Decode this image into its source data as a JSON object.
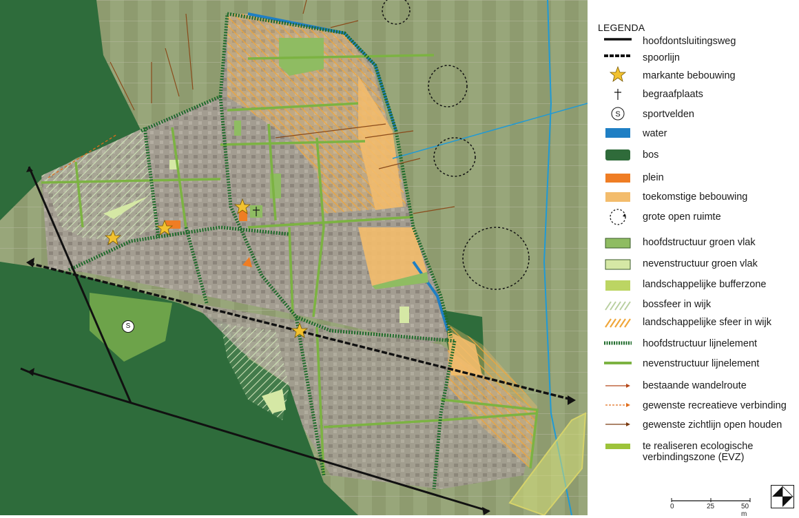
{
  "legend": {
    "title": "LEGENDA",
    "items": [
      {
        "symbol": "thick-black-line",
        "label": "hoofdontsluitingsweg"
      },
      {
        "symbol": "dashed-black-line",
        "label": "spoorlijn"
      },
      {
        "symbol": "star-icon",
        "label": "markante bebouwing"
      },
      {
        "symbol": "cross-icon",
        "label": "begraafplaats"
      },
      {
        "symbol": "sport-circle-icon",
        "label": "sportvelden",
        "glyph": "S"
      },
      {
        "symbol": "blue-swatch",
        "label": "water",
        "color": "#1f7fc4"
      },
      {
        "symbol": "dark-green-swatch",
        "label": "bos",
        "color": "#2f6b3a"
      },
      {
        "symbol": "orange-swatch",
        "label": "plein",
        "color": "#ef7d24"
      },
      {
        "symbol": "light-orange-swatch",
        "label": "toekomstige bebouwing",
        "color": "#f3bc6c"
      },
      {
        "symbol": "dotted-circle-arrow-icon",
        "label": "grote open ruimte"
      },
      {
        "symbol": "green-box",
        "label": "hoofdstructuur groen vlak",
        "color": "#8fbc62"
      },
      {
        "symbol": "light-green-box",
        "label": "nevenstructuur groen vlak",
        "color": "#d5e8a5"
      },
      {
        "symbol": "yellowgreen-swatch",
        "label": "landschappelijke bufferzone",
        "color": "#bcd563"
      },
      {
        "symbol": "green-hatch",
        "label": "bossfeer in wijk"
      },
      {
        "symbol": "orange-hatch",
        "label": "landschappelijke sfeer in wijk"
      },
      {
        "symbol": "dark-green-dotted-line",
        "label": "hoofdstructuur lijnelement",
        "color": "#1f6b2b"
      },
      {
        "symbol": "light-green-line",
        "label": "nevenstructuur lijnelement",
        "color": "#7cb342"
      },
      {
        "symbol": "brown-arrow",
        "label": "bestaande wandelroute"
      },
      {
        "symbol": "orange-dashed-arrow",
        "label": "gewenste recreatieve verbinding"
      },
      {
        "symbol": "brown-arrow-2",
        "label": "gewenste zichtlijn open houden"
      },
      {
        "symbol": "lime-bar",
        "label": "te realiseren ecologische verbindingszone (EVZ)"
      }
    ]
  },
  "scale": {
    "ticks": [
      "0",
      "25",
      "50 m"
    ]
  },
  "map": {
    "sport_label": "S",
    "colors": {
      "forest": "#2e6c3b",
      "urban": "#9a9488",
      "fields": "#8f9a70",
      "water": "#1f7fc4",
      "future": "#f3bc6c",
      "plein": "#ef7d24",
      "main_green": "#1f6b2b",
      "side_green": "#7cb342",
      "road": "#111111"
    }
  }
}
